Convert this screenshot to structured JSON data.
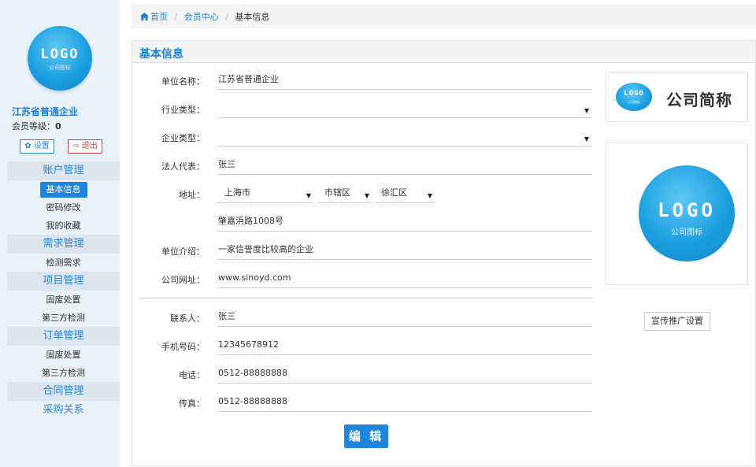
{
  "sidebar": {
    "logo": {
      "word": "LOGO",
      "sub": "公司图标"
    },
    "company_name": "江苏省普通企业",
    "member_level_label": "会员等级：",
    "member_level_value": "0",
    "settings_label": "设置",
    "logout_label": "退出",
    "menu": [
      {
        "type": "group",
        "label": "账户管理"
      },
      {
        "type": "item",
        "label": "基本信息",
        "active": true
      },
      {
        "type": "item",
        "label": "密码修改"
      },
      {
        "type": "item",
        "label": "我的收藏"
      },
      {
        "type": "group",
        "label": "需求管理"
      },
      {
        "type": "item",
        "label": "检测需求"
      },
      {
        "type": "group",
        "label": "项目管理"
      },
      {
        "type": "item",
        "label": "固废处置"
      },
      {
        "type": "item",
        "label": "第三方检测"
      },
      {
        "type": "group",
        "label": "订单管理"
      },
      {
        "type": "item",
        "label": "固废处置"
      },
      {
        "type": "item",
        "label": "第三方检测"
      },
      {
        "type": "group",
        "label": "合同管理"
      },
      {
        "type": "group",
        "label": "采购关系"
      }
    ]
  },
  "breadcrumb": {
    "home": "首页",
    "center": "会员中心",
    "current": "基本信息"
  },
  "panel": {
    "title": "基本信息",
    "fields": {
      "unit_name": {
        "label": "单位名称：",
        "value": "江苏省普通企业"
      },
      "industry": {
        "label": "行业类型：",
        "value": ""
      },
      "company_type": {
        "label": "企业类型：",
        "value": ""
      },
      "legal_rep": {
        "label": "法人代表：",
        "value": "张三"
      },
      "address": {
        "label": "地址：",
        "province": "上海市",
        "city": "市辖区",
        "district": "徐汇区",
        "detail": "肇嘉浜路1008号"
      },
      "intro": {
        "label": "单位介绍：",
        "value": "一家信誉度比较高的企业"
      },
      "website": {
        "label": "公司网址：",
        "value": "www.sinoyd.com"
      },
      "contact": {
        "label": "联系人：",
        "value": "张三"
      },
      "mobile": {
        "label": "手机号码：",
        "value": "12345678912"
      },
      "phone": {
        "label": "电话：",
        "value": "0512-88888888"
      },
      "fax": {
        "label": "传真：",
        "value": "0512-88888888"
      }
    },
    "edit_label": "编 辑",
    "brand": {
      "logo_word": "LOGO",
      "logo_sub": "公司图标",
      "short_name": "公司简称"
    },
    "big_logo": {
      "word": "LOGO",
      "sub": "公司图标"
    },
    "promo_label": "宣传推广设置"
  },
  "colors": {
    "accent": "#1f86e0",
    "danger": "#e03b3b",
    "sidebar_bg": "#e9f1f9",
    "group_bg": "#dde5ee"
  }
}
